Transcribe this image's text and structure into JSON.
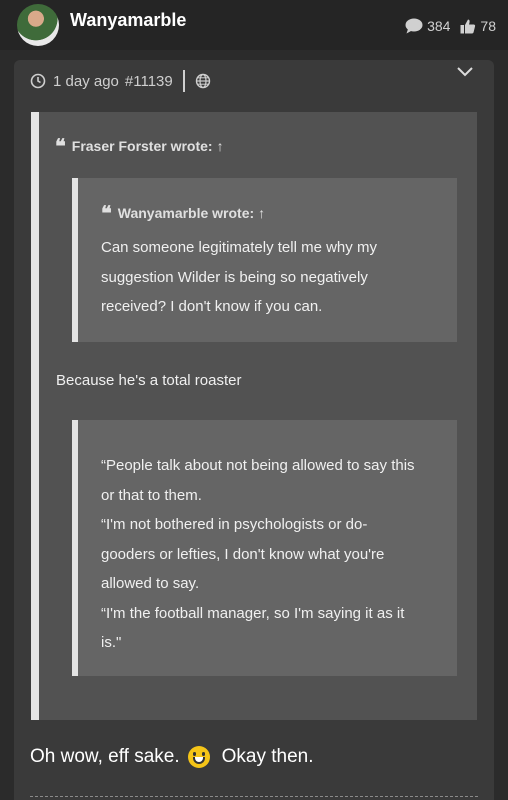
{
  "header": {
    "username": "Wanyamarble",
    "comments_count": "384",
    "likes_count": "78"
  },
  "post": {
    "time": "1 day ago",
    "post_id": "#11139",
    "outer_quote": {
      "author_label": "Fraser Forster wrote:",
      "inner_quote": {
        "author_label": "Wanyamarble wrote:",
        "lines": [
          "Can someone legitimately tell me why my",
          "suggestion Wilder is being so negatively",
          "received? I don't know if you can."
        ]
      },
      "body_text": "Because he's a total roaster",
      "cited_quote_lines": [
        "“People talk about not being allowed to say this",
        "or that to them.",
        "“I'm not bothered in psychologists or do-",
        "gooders or lefties, I don't know what you're",
        "allowed to say.",
        "“I'm the football manager, so I'm saying it as it",
        "is.\""
      ]
    },
    "reply_before_emoji": "Oh wow, eff sake.",
    "reply_after_emoji": "Okay then."
  }
}
